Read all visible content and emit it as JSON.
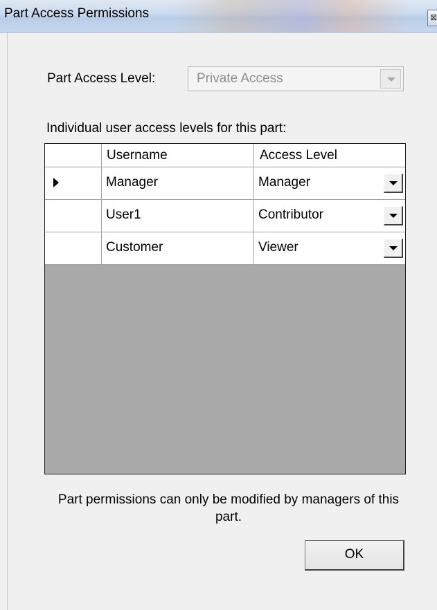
{
  "window": {
    "title": "Part Access Permissions",
    "close_glyph": "⊠"
  },
  "access_level": {
    "label": "Part Access Level:",
    "value": "Private Access",
    "enabled": false
  },
  "grid": {
    "caption": "Individual user access levels for this part:",
    "columns": [
      "Username",
      "Access Level"
    ],
    "rows": [
      {
        "username": "Manager",
        "access_level": "Manager",
        "current": true
      },
      {
        "username": "User1",
        "access_level": "Contributor",
        "current": false
      },
      {
        "username": "Customer",
        "access_level": "Viewer",
        "current": false
      }
    ]
  },
  "footer": {
    "note": "Part permissions can only be modified by managers of this part.",
    "ok_label": "OK"
  },
  "colors": {
    "grid_background": "#a9a9a9",
    "dialog_background": "#f0f0f0",
    "disabled_text": "#8f8f8f"
  }
}
